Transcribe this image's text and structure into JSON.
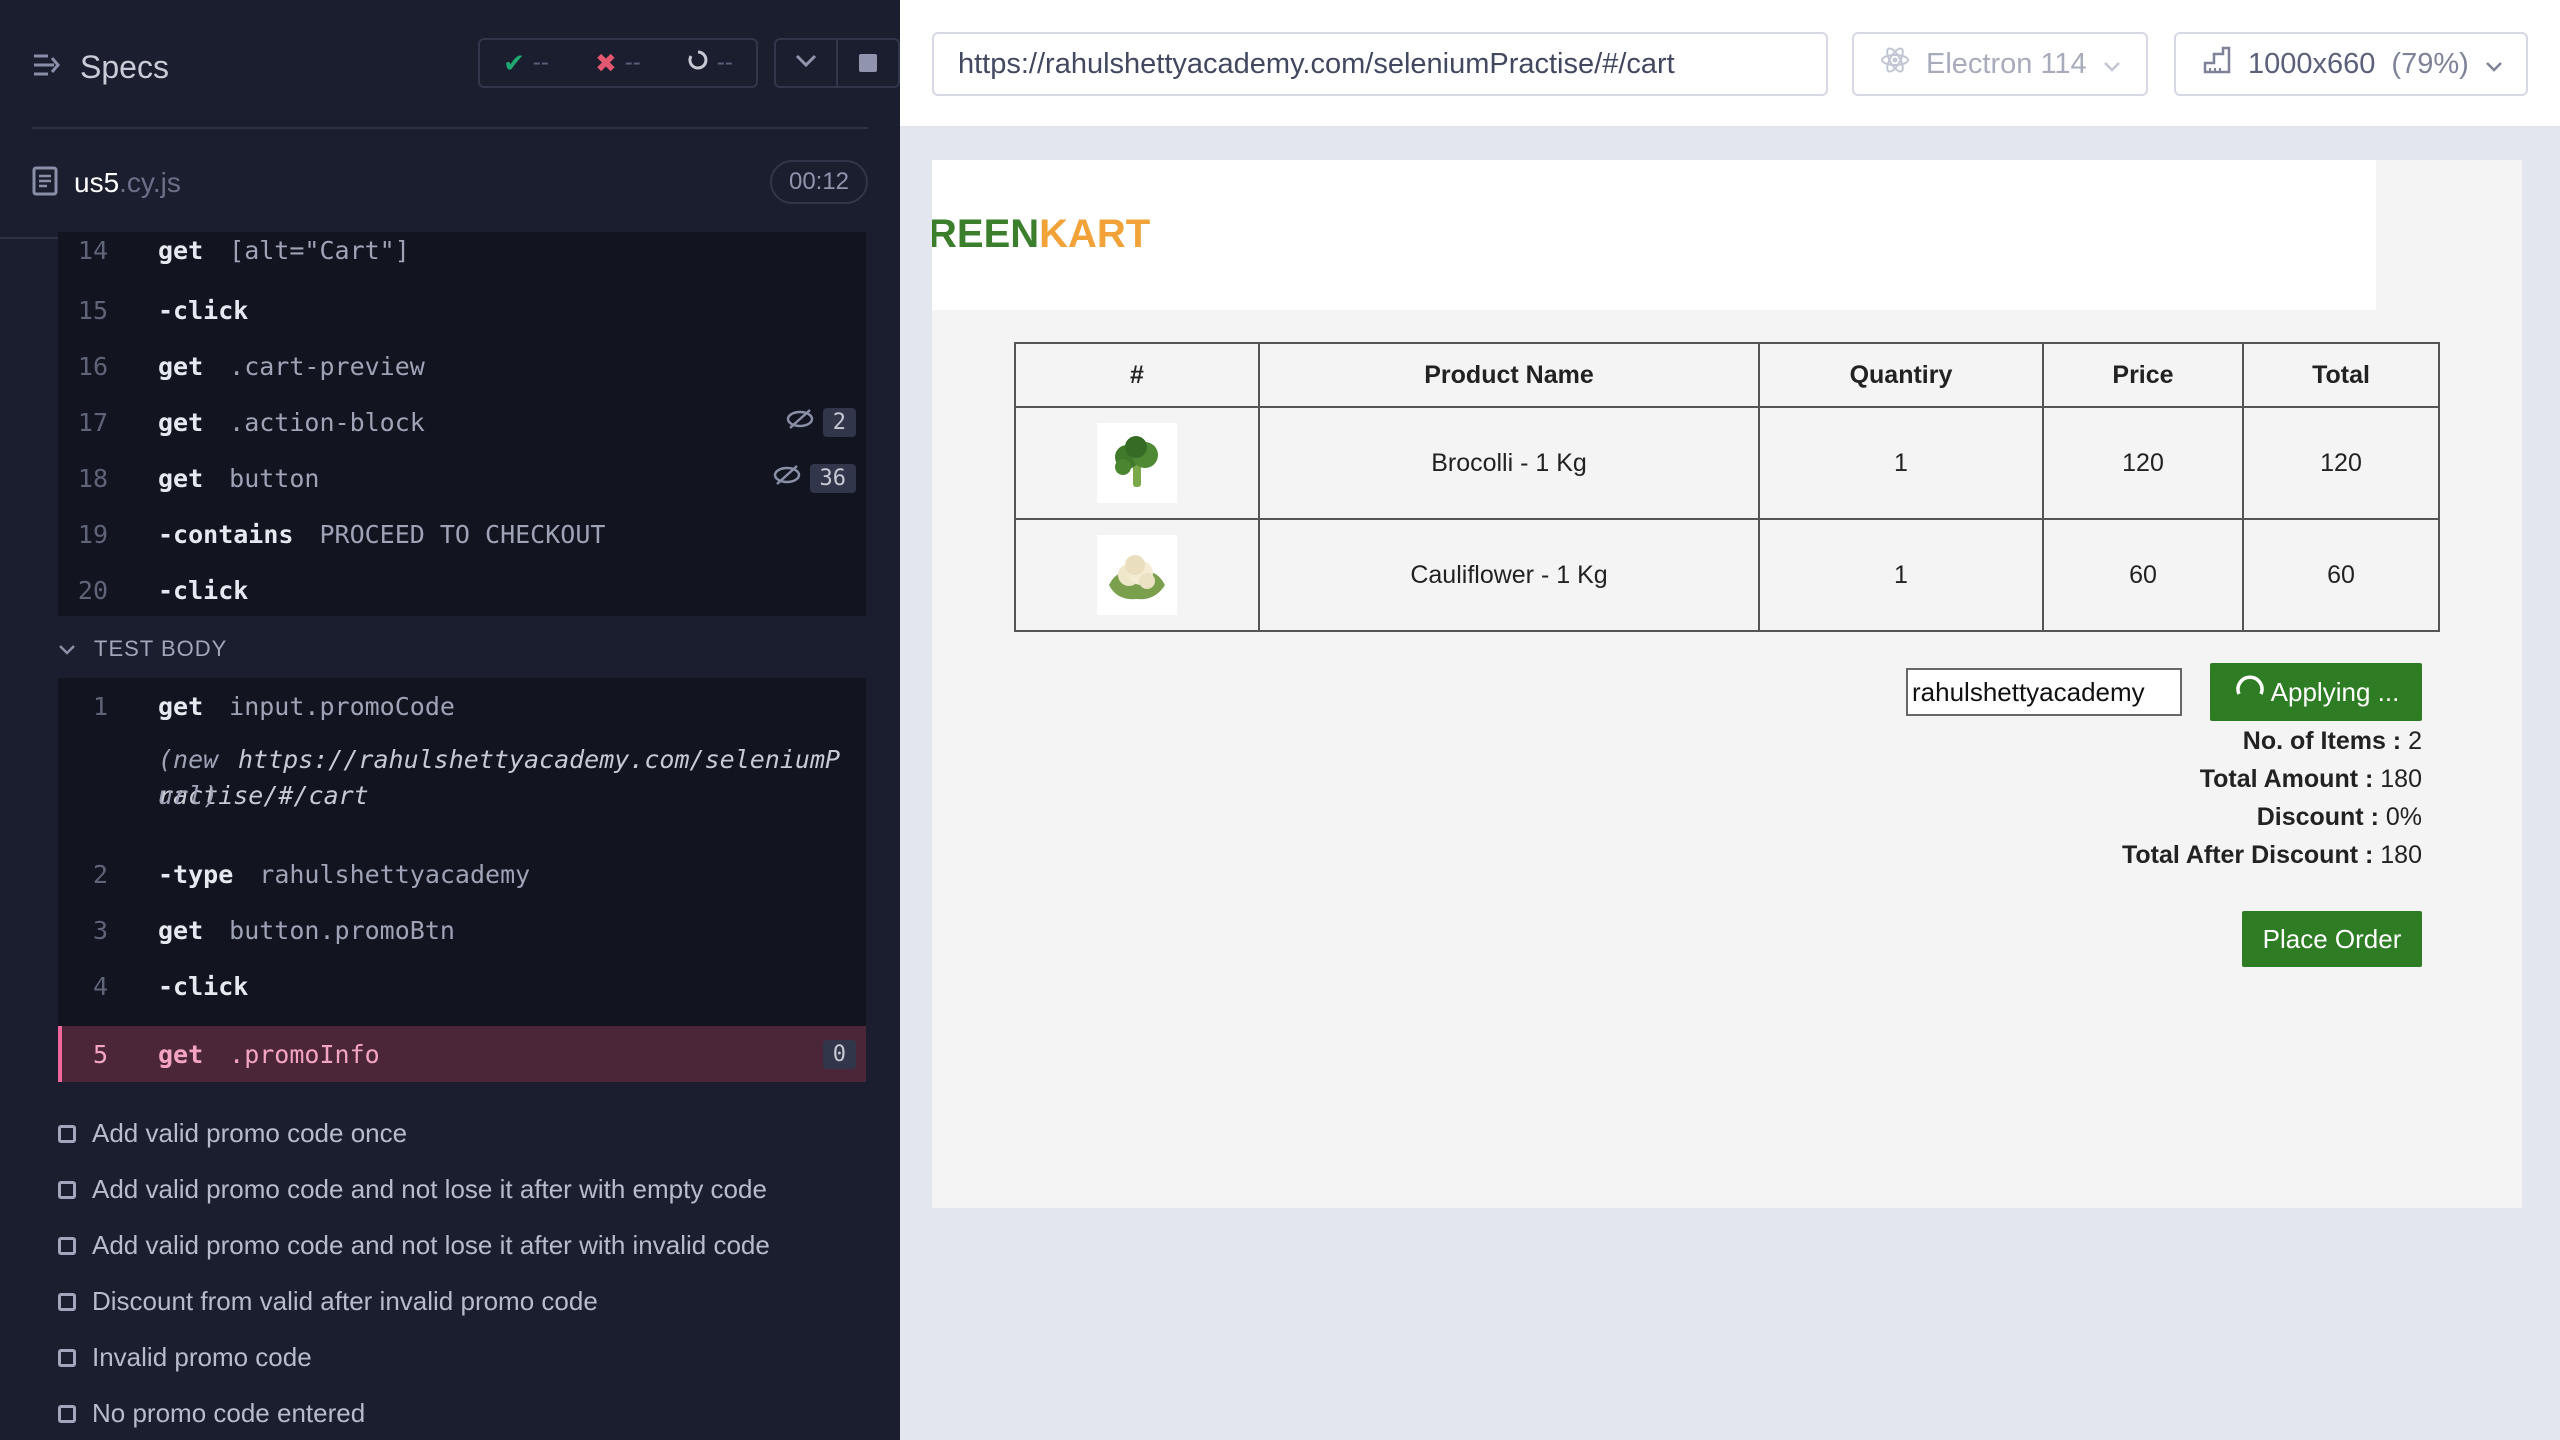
{
  "reporter": {
    "specs_title": "Specs",
    "stats": {
      "passed": "--",
      "failed": "--",
      "pending": "--"
    },
    "spec_file": {
      "name": "us5",
      "ext": ".cy.js",
      "duration": "00:12"
    },
    "before_commands": [
      {
        "num": "14",
        "name": "get",
        "msg": "[alt=\"Cart\"]"
      },
      {
        "num": "15",
        "name": "-click",
        "msg": ""
      },
      {
        "num": "16",
        "name": "get",
        "msg": ".cart-preview"
      },
      {
        "num": "17",
        "name": "get",
        "msg": ".action-block",
        "count": "2"
      },
      {
        "num": "18",
        "name": "get",
        "msg": "button",
        "count": "36"
      },
      {
        "num": "19",
        "name": "-contains",
        "msg": "PROCEED TO CHECKOUT"
      },
      {
        "num": "20",
        "name": "-click",
        "msg": ""
      }
    ],
    "test_body_label": "TEST BODY",
    "body_commands": [
      {
        "num": "1",
        "name": "get",
        "msg": "input.promoCode"
      },
      {
        "num": "",
        "name": "(new url)",
        "msg": "https://rahulshettyacademy.com/seleniumPractise/#/cart"
      },
      {
        "num": "2",
        "name": "-type",
        "msg": "rahulshettyacademy"
      },
      {
        "num": "3",
        "name": "get",
        "msg": "button.promoBtn"
      },
      {
        "num": "4",
        "name": "-click",
        "msg": ""
      },
      {
        "num": "5",
        "name": "get",
        "msg": ".promoInfo",
        "count": "0"
      }
    ],
    "tests": [
      "Add valid promo code once",
      "Add valid promo code and not lose it after with empty code",
      "Add valid promo code and not lose it after with invalid code",
      "Discount from valid after invalid promo code",
      "Invalid promo code",
      "No promo code entered"
    ]
  },
  "topbar": {
    "url": "https://rahulshettyacademy.com/seleniumPractise/#/cart",
    "browser": "Electron 114",
    "viewport": "1000x660",
    "zoom": "(79%)"
  },
  "app": {
    "brand_green": "REEN",
    "brand_orange": "KART",
    "table_headers": [
      "#",
      "Product Name",
      "Quantiry",
      "Price",
      "Total"
    ],
    "rows": [
      {
        "product": "Brocolli - 1 Kg",
        "quantity": "1",
        "price": "120",
        "total": "120",
        "icon": "broccoli-image"
      },
      {
        "product": "Cauliflower - 1 Kg",
        "quantity": "1",
        "price": "60",
        "total": "60",
        "icon": "cauliflower-image"
      }
    ],
    "promo_value": "rahulshettyacademy",
    "promo_button": "Applying ...",
    "summary": {
      "items_label": "No. of Items :",
      "items_value": "2",
      "amount_label": "Total Amount :",
      "amount_value": "180",
      "discount_label": "Discount :",
      "discount_value": "0%",
      "after_label": "Total After Discount :",
      "after_value": "180"
    },
    "place_order": "Place Order"
  },
  "colors": {
    "brand_green": "#3b7f2c",
    "brand_orange": "#f1a33a",
    "button_green": "#2e7d24",
    "active_cmd": "#f5a3c3"
  }
}
